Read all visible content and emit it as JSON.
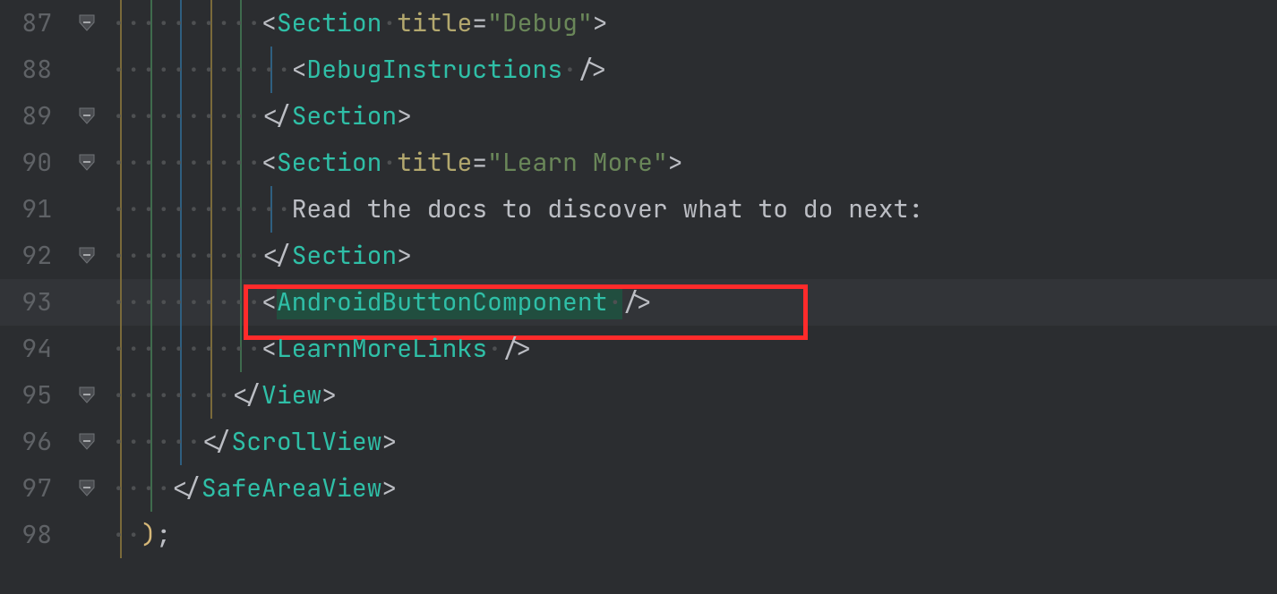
{
  "colors": {
    "bg": "#2b2d30",
    "text": "#bcbec4",
    "tag": "#2fbfa7",
    "attr": "#b3a86e",
    "string": "#6a8759",
    "lineNum": "#5f6266",
    "indentDot": "#4e5052",
    "guideYellow": "#7a6a3a",
    "guideGreen": "#3f6b4d",
    "guideBlue": "#2f5f80",
    "highlightLine": "#323438",
    "selection": "#214e3f",
    "annotation": "#ff2b2b"
  },
  "indentDot": "·",
  "lines": {
    "87": {
      "num": "87",
      "fold": true,
      "indent": 10,
      "tokens": [
        {
          "t": "punct",
          "v": "<"
        },
        {
          "t": "tag",
          "v": "Section"
        },
        {
          "t": "spc",
          "v": " "
        },
        {
          "t": "attr",
          "v": "title"
        },
        {
          "t": "punct",
          "v": "="
        },
        {
          "t": "str",
          "v": "\"Debug\""
        },
        {
          "t": "punct",
          "v": ">"
        }
      ],
      "guides": [
        "yellow",
        "green",
        "blue",
        "yellow",
        "green"
      ]
    },
    "88": {
      "num": "88",
      "fold": false,
      "indent": 12,
      "tokens": [
        {
          "t": "punct",
          "v": "<"
        },
        {
          "t": "tag",
          "v": "DebugInstructions"
        },
        {
          "t": "spc",
          "v": " "
        },
        {
          "t": "punct",
          "v": "/>"
        }
      ],
      "guides": [
        "yellow",
        "green",
        "blue",
        "yellow",
        "green",
        "blue"
      ]
    },
    "89": {
      "num": "89",
      "fold": true,
      "indent": 10,
      "tokens": [
        {
          "t": "punct",
          "v": "</"
        },
        {
          "t": "tag",
          "v": "Section"
        },
        {
          "t": "punct",
          "v": ">"
        }
      ],
      "guides": [
        "yellow",
        "green",
        "blue",
        "yellow",
        "green"
      ]
    },
    "90": {
      "num": "90",
      "fold": true,
      "indent": 10,
      "tokens": [
        {
          "t": "punct",
          "v": "<"
        },
        {
          "t": "tag",
          "v": "Section"
        },
        {
          "t": "spc",
          "v": " "
        },
        {
          "t": "attr",
          "v": "title"
        },
        {
          "t": "punct",
          "v": "="
        },
        {
          "t": "str",
          "v": "\"Learn More\""
        },
        {
          "t": "punct",
          "v": ">"
        }
      ],
      "guides": [
        "yellow",
        "green",
        "blue",
        "yellow",
        "green"
      ]
    },
    "91": {
      "num": "91",
      "fold": false,
      "indent": 12,
      "tokens": [
        {
          "t": "text",
          "v": "Read the docs to discover what to do next:"
        }
      ],
      "guides": [
        "yellow",
        "green",
        "blue",
        "yellow",
        "green",
        "blue"
      ]
    },
    "92": {
      "num": "92",
      "fold": true,
      "indent": 10,
      "tokens": [
        {
          "t": "punct",
          "v": "</"
        },
        {
          "t": "tag",
          "v": "Section"
        },
        {
          "t": "punct",
          "v": ">"
        }
      ],
      "guides": [
        "yellow",
        "green",
        "blue",
        "yellow",
        "green"
      ]
    },
    "93": {
      "num": "93",
      "fold": false,
      "indent": 10,
      "current": true,
      "selected": "AndroidButtonComponent",
      "tokens": [
        {
          "t": "punct",
          "v": "<"
        },
        {
          "t": "tag",
          "v": "AndroidButtonComponent"
        },
        {
          "t": "spc",
          "v": " "
        },
        {
          "t": "punct",
          "v": "/>"
        }
      ],
      "guides": [
        "yellow",
        "green",
        "blue",
        "yellow",
        "green"
      ],
      "annotation": true
    },
    "94": {
      "num": "94",
      "fold": false,
      "indent": 10,
      "tokens": [
        {
          "t": "punct",
          "v": "<"
        },
        {
          "t": "tag",
          "v": "LearnMoreLinks"
        },
        {
          "t": "spc",
          "v": " "
        },
        {
          "t": "punct",
          "v": "/>"
        }
      ],
      "guides": [
        "yellow",
        "green",
        "blue",
        "yellow",
        "green"
      ]
    },
    "95": {
      "num": "95",
      "fold": true,
      "indent": 8,
      "tokens": [
        {
          "t": "punct",
          "v": "</"
        },
        {
          "t": "tag",
          "v": "View"
        },
        {
          "t": "punct",
          "v": ">"
        }
      ],
      "guides": [
        "yellow",
        "green",
        "blue",
        "yellow"
      ]
    },
    "96": {
      "num": "96",
      "fold": true,
      "indent": 6,
      "tokens": [
        {
          "t": "punct",
          "v": "</"
        },
        {
          "t": "tag",
          "v": "ScrollView"
        },
        {
          "t": "punct",
          "v": ">"
        }
      ],
      "guides": [
        "yellow",
        "green",
        "blue"
      ]
    },
    "97": {
      "num": "97",
      "fold": true,
      "indent": 4,
      "tokens": [
        {
          "t": "punct",
          "v": "</"
        },
        {
          "t": "tag",
          "v": "SafeAreaView"
        },
        {
          "t": "punct",
          "v": ">"
        }
      ],
      "guides": [
        "yellow",
        "green"
      ]
    },
    "98": {
      "num": "98",
      "fold": false,
      "indent": 2,
      "tokens": [
        {
          "t": "brack",
          "v": ")"
        },
        {
          "t": "paren",
          "v": ";"
        }
      ],
      "guides": [
        "yellow"
      ]
    }
  },
  "lineOrder": [
    "87",
    "88",
    "89",
    "90",
    "91",
    "92",
    "93",
    "94",
    "95",
    "96",
    "97",
    "98"
  ],
  "highlightedLine": "93"
}
